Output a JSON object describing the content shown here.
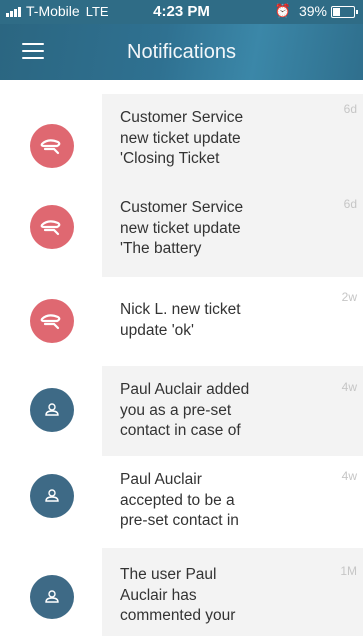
{
  "status_bar": {
    "carrier": "T-Mobile",
    "network": "LTE",
    "time": "4:23 PM",
    "battery_percent": "39%",
    "alarm_icon": "alarm-clock-icon"
  },
  "nav": {
    "title": "Notifications",
    "menu_icon": "hamburger-menu-icon"
  },
  "notifications": [
    {
      "avatar": "brand-logo",
      "lines": [
        "Customer Service",
        "new ticket update",
        "'Closing Ticket"
      ],
      "time": "6d"
    },
    {
      "avatar": "brand-logo",
      "lines": [
        "Customer Service",
        "new ticket update",
        "'The battery"
      ],
      "time": "6d"
    },
    {
      "avatar": "brand-logo",
      "lines": [
        "Nick L. new ticket",
        "update 'ok'"
      ],
      "time": "2w"
    },
    {
      "avatar": "user-icon",
      "lines": [
        "Paul Auclair added",
        "you as a pre-set",
        "contact in case of"
      ],
      "time": "4w"
    },
    {
      "avatar": "user-icon",
      "lines": [
        "Paul Auclair",
        "accepted to be a",
        "pre-set contact in"
      ],
      "time": "4w"
    },
    {
      "avatar": "user-icon",
      "lines": [
        "The user Paul",
        "Auclair has",
        "commented your"
      ],
      "time": "1M"
    }
  ],
  "colors": {
    "header": "#2f6f8d",
    "brand_avatar": "#df6871",
    "user_avatar": "#3e6a86",
    "card_bg": "#f3f3f3"
  }
}
